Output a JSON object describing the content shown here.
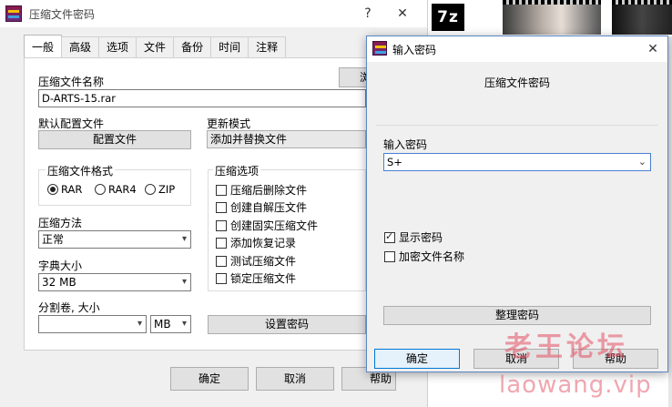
{
  "bg_window": {
    "title": "压缩文件密码",
    "help_glyph": "?",
    "close_glyph": "✕",
    "tabs": [
      "一般",
      "高级",
      "选项",
      "文件",
      "备份",
      "时间",
      "注释"
    ],
    "archive_name_label": "压缩文件名称",
    "browse_label": "浏",
    "archive_name_value": "D-ARTS-15.rar",
    "default_profile_label": "默认配置文件",
    "profile_button": "配置文件",
    "update_mode_label": "更新模式",
    "update_mode_value": "添加并替换文件",
    "format_group_label": "压缩文件格式",
    "format_options": [
      "RAR",
      "RAR4",
      "ZIP"
    ],
    "format_selected": "RAR",
    "method_label": "压缩方法",
    "method_value": "正常",
    "dict_label": "字典大小",
    "dict_value": "32 MB",
    "split_label": "分割卷, 大小",
    "split_value": "",
    "split_unit": "MB",
    "options_group_label": "压缩选项",
    "options": [
      {
        "label": "压缩后删除文件",
        "checked": false
      },
      {
        "label": "创建自解压文件",
        "checked": false
      },
      {
        "label": "创建固实压缩文件",
        "checked": false
      },
      {
        "label": "添加恢复记录",
        "checked": false
      },
      {
        "label": "测试压缩文件",
        "checked": false
      },
      {
        "label": "锁定压缩文件",
        "checked": false
      }
    ],
    "set_password_button": "设置密码",
    "ok": "确定",
    "cancel": "取消",
    "help": "帮助"
  },
  "sevenz_logo": "7z",
  "dialog": {
    "title": "输入密码",
    "close_glyph": "✕",
    "heading": "压缩文件密码",
    "password_label": "输入密码",
    "password_value": "S+",
    "show_password_label": "显示密码",
    "show_password_checked": true,
    "encrypt_names_label": "加密文件名称",
    "encrypt_names_checked": false,
    "organize_button": "整理密码",
    "ok": "确定",
    "cancel": "取消",
    "help": "帮助"
  },
  "watermark": {
    "line1": "老王论坛",
    "line2": "laowang.vip"
  }
}
